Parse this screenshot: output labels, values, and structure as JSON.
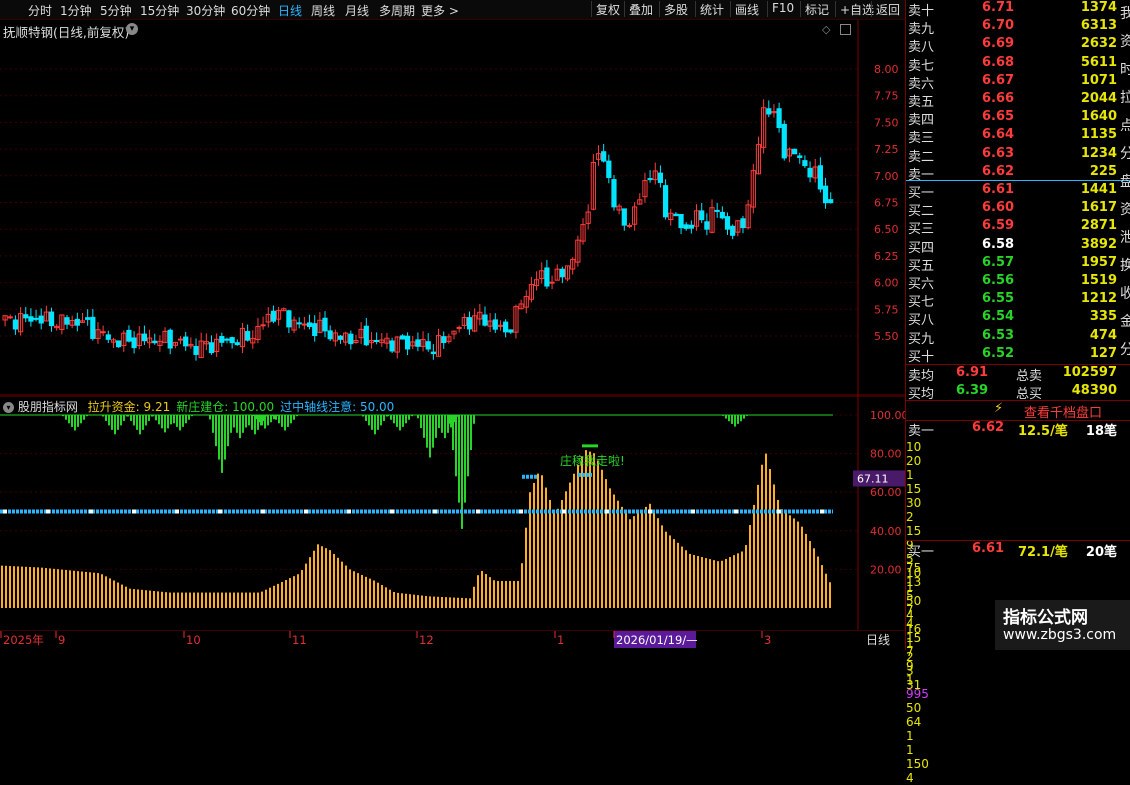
{
  "toolbar": {
    "periods": [
      "分时",
      "1分钟",
      "5分钟",
      "15分钟",
      "30分钟",
      "60分钟",
      "日线",
      "周线",
      "月线",
      "多周期",
      "更多 >"
    ],
    "active": "日线",
    "actions": [
      "复权",
      "叠加",
      "多股",
      "统计",
      "画线",
      "F10",
      "标记",
      "+自选",
      "返回"
    ]
  },
  "stock": {
    "title": "抚顺特钢(日线,前复权)",
    "price_axis": [
      "8.00",
      "7.75",
      "7.50",
      "7.25",
      "7.00",
      "6.75",
      "6.50",
      "6.25",
      "6.00",
      "5.75",
      "5.50"
    ]
  },
  "indicator": {
    "name": "股朋指标网",
    "items": [
      {
        "label": "拉升资金:",
        "value": "9.21",
        "color": "#e8c81a"
      },
      {
        "label": "新庄建仓:",
        "value": "100.00",
        "color": "#28d428"
      },
      {
        "label": "过中轴线注意:",
        "value": "50.00",
        "color": "#29b6ff"
      }
    ],
    "axis": [
      "100.00",
      "80.00",
      "60.00",
      "40.00",
      "20.00"
    ],
    "marker_value": "67.11",
    "annotation": "庄稼我走啦!"
  },
  "xaxis": {
    "labels": [
      "2025年",
      "9",
      "10",
      "11",
      "12",
      "1",
      "2026/01/19/—",
      "3"
    ],
    "period": "日线"
  },
  "book": {
    "sell": [
      {
        "label": "卖十",
        "price": "6.71",
        "vol": "1374"
      },
      {
        "label": "卖九",
        "price": "6.70",
        "vol": "6313"
      },
      {
        "label": "卖八",
        "price": "6.69",
        "vol": "2632"
      },
      {
        "label": "卖七",
        "price": "6.68",
        "vol": "5611"
      },
      {
        "label": "卖六",
        "price": "6.67",
        "vol": "1071"
      },
      {
        "label": "卖五",
        "price": "6.66",
        "vol": "2044"
      },
      {
        "label": "卖四",
        "price": "6.65",
        "vol": "1640"
      },
      {
        "label": "卖三",
        "price": "6.64",
        "vol": "1135"
      },
      {
        "label": "卖二",
        "price": "6.63",
        "vol": "1234"
      },
      {
        "label": "卖一",
        "price": "6.62",
        "vol": "225"
      }
    ],
    "buy": [
      {
        "label": "买一",
        "price": "6.61",
        "vol": "1441"
      },
      {
        "label": "买二",
        "price": "6.60",
        "vol": "1617"
      },
      {
        "label": "买三",
        "price": "6.59",
        "vol": "2871"
      },
      {
        "label": "买四",
        "price": "6.58",
        "vol": "3892"
      },
      {
        "label": "买五",
        "price": "6.57",
        "vol": "1957"
      },
      {
        "label": "买六",
        "price": "6.56",
        "vol": "1519"
      },
      {
        "label": "买七",
        "price": "6.55",
        "vol": "1212"
      },
      {
        "label": "买八",
        "price": "6.54",
        "vol": "335"
      },
      {
        "label": "买九",
        "price": "6.53",
        "vol": "474"
      },
      {
        "label": "买十",
        "price": "6.52",
        "vol": "127"
      }
    ],
    "avg_sell": {
      "label": "卖均",
      "price": "6.91",
      "total_label": "总卖",
      "total": "102597"
    },
    "avg_buy": {
      "label": "买均",
      "price": "6.39",
      "total_label": "总买",
      "total": "48390"
    },
    "thousand_button": "查看千档盘口",
    "sell1": {
      "label": "卖一",
      "price": "6.62",
      "per": "12.5/笔",
      "count": "18笔"
    },
    "sell1_grid": [
      [
        "10",
        "20",
        "1",
        "15",
        "30"
      ],
      [
        "2",
        "15",
        "9",
        "5",
        "10"
      ],
      [
        "1",
        "50",
        "4",
        "16",
        "1"
      ],
      [
        "2",
        "3",
        "31",
        "",
        ""
      ]
    ],
    "buy1": {
      "label": "买一",
      "price": "6.61",
      "per": "72.1/笔",
      "count": "20笔"
    },
    "buy1_grid": [
      [
        "75",
        "13",
        "5",
        "7",
        "4"
      ],
      [
        "15",
        "7",
        "9",
        "1",
        "995"
      ],
      [
        "50",
        "64",
        "1",
        "1",
        "150"
      ],
      [
        "4",
        "",
        "",
        "",
        ""
      ]
    ],
    "side_text": [
      "我",
      "资",
      "时",
      "拉",
      "点",
      "分",
      "盘",
      "资",
      "泄",
      "换",
      "收",
      "金",
      "分"
    ]
  },
  "watermark": {
    "line1": "指标公式网",
    "line2": "www.zbgs3.com"
  },
  "colors": {
    "up": "#ff3c3c",
    "down": "#00e5ff",
    "vol": "#ffb020",
    "green": "#28d428",
    "blue": "#29b6ff"
  }
}
